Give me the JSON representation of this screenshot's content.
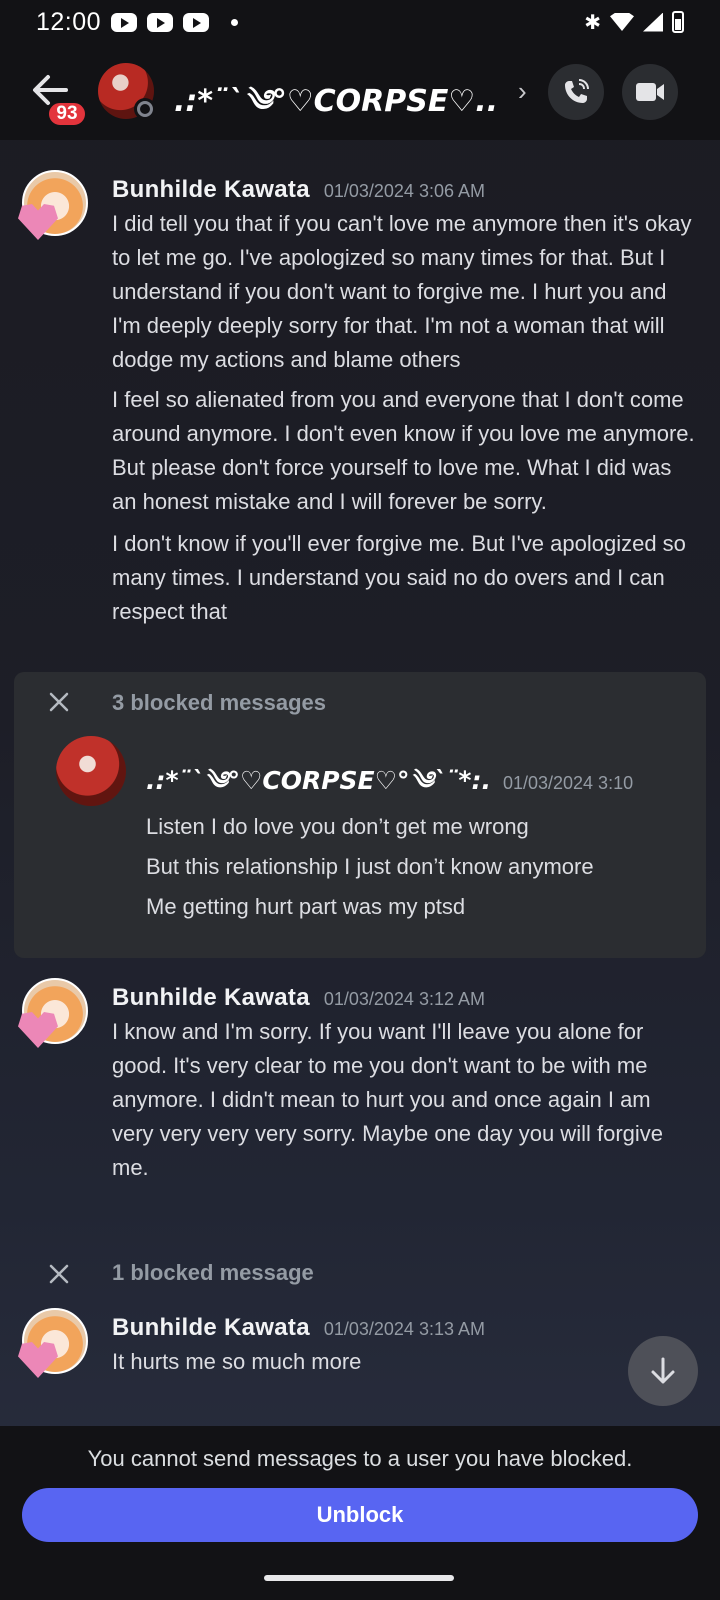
{
  "status_bar": {
    "time": "12:00"
  },
  "header": {
    "unread_count": "93",
    "channel_name": ".:*¨`༄°♡CORPSE♡..."
  },
  "messages": [
    {
      "author": "Bunhilde Kawata",
      "timestamp": "01/03/2024 3:06 AM",
      "paragraphs": [
        "I did tell you that if you can't love me anymore then it's okay to let me go. I've apologized so many times for that. But I understand if you don't want to forgive me. I hurt you and I'm deeply deeply sorry for that. I'm not a woman that will dodge my actions and blame others",
        "I feel so alienated from you and everyone that I don't come around anymore. I don't even know if you love me anymore. But please don't force yourself to love me. What I did was an honest mistake and I will forever be sorry.",
        "I don't know if you'll ever forgive me. But I've apologized so many times. I understand you said no do overs and I can respect that"
      ]
    },
    {
      "author": "Bunhilde Kawata",
      "timestamp": "01/03/2024 3:12 AM",
      "paragraphs": [
        "I know and I'm sorry. If you want I'll leave you alone for good. It's very clear to me you don't want to be with me anymore. I didn't mean to hurt you and once again I am very very very very sorry. Maybe one day you will forgive me."
      ]
    },
    {
      "author": "Bunhilde Kawata",
      "timestamp": "01/03/2024 3:13 AM",
      "paragraphs": [
        "It hurts me so much more"
      ]
    }
  ],
  "blocked_group": {
    "label": "3 blocked messages",
    "author": ".:*¨`༄°♡CORPSE♡°༄`¨*:.",
    "timestamp": "01/03/2024 3:10",
    "lines": [
      "Listen I do love you don’t get me wrong",
      "But this relationship I just don’t know anymore",
      "Me getting hurt part was my ptsd"
    ]
  },
  "blocked_inline": {
    "label": "1 blocked message"
  },
  "footer": {
    "note": "You cannot send messages to a user you have blocked.",
    "unblock_label": "Unblock"
  },
  "colors": {
    "accent": "#5865f2",
    "badge": "#e3343c",
    "background": "#1d1e27",
    "panel": "#2b2d31"
  }
}
